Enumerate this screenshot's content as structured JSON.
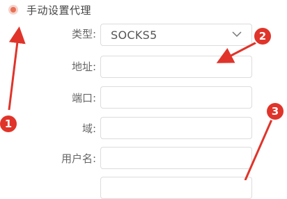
{
  "proxy_mode": {
    "label": "手动设置代理",
    "selected": true
  },
  "fields": {
    "type_label": "类型:",
    "type_value": "SOCKS5",
    "address_label": "地址:",
    "address_value": "",
    "port_label": "端口:",
    "port_value": "",
    "domain_label": "域:",
    "domain_value": "",
    "username_label": "用户名:",
    "username_value": ""
  },
  "annotations": {
    "marker_1": "1",
    "marker_2": "2",
    "marker_3": "3"
  },
  "colors": {
    "accent": "#e87055",
    "annotation_red": "#e0342a"
  },
  "icons": {
    "dropdown": "chevron-down-icon"
  }
}
